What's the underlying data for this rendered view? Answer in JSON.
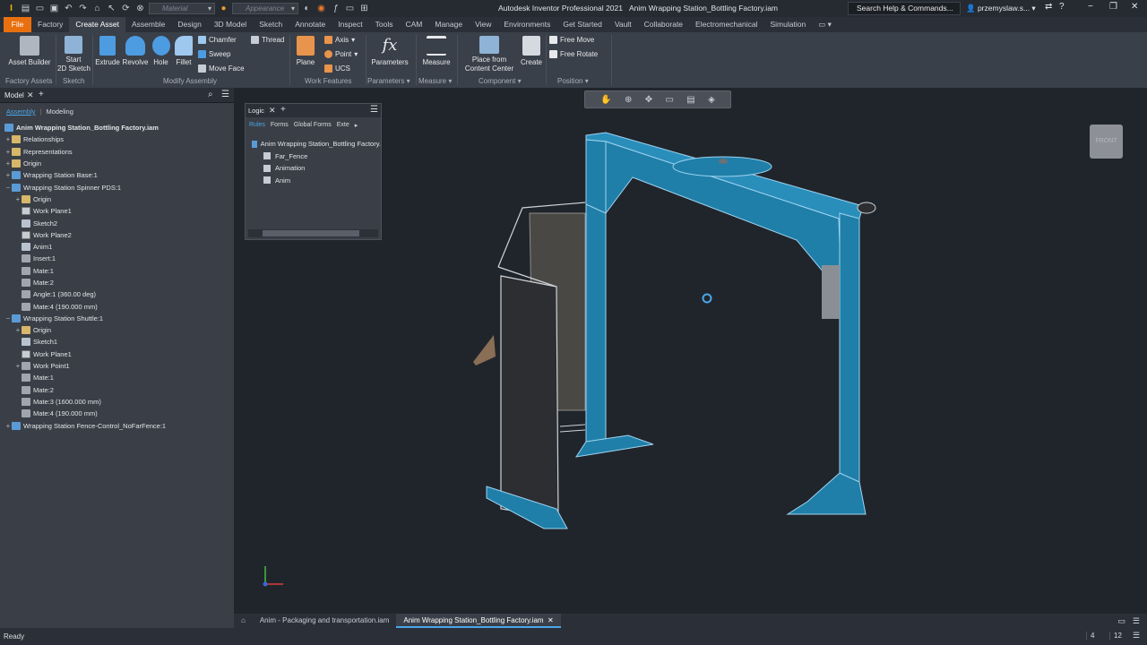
{
  "title": {
    "app": "Autodesk Inventor Professional 2021",
    "document": "Anim Wrapping Station_Bottling Factory.iam",
    "material_placeholder": "Material",
    "appearance_placeholder": "Appearance",
    "search": "Search Help & Commands...",
    "user": "przemyslaw.s..."
  },
  "menu": {
    "file": "File",
    "tabs": [
      "Factory",
      "Create Asset",
      "Assemble",
      "Design",
      "3D Model",
      "Sketch",
      "Annotate",
      "Inspect",
      "Tools",
      "CAM",
      "Manage",
      "View",
      "Environments",
      "Get Started",
      "Vault",
      "Collaborate",
      "Electromechanical",
      "Simulation"
    ],
    "active_tab": "Create Asset"
  },
  "ribbon": {
    "asset_builder": "Asset Builder",
    "start_sketch_1": "Start",
    "start_sketch_2": "2D Sketch",
    "extrude": "Extrude",
    "revolve": "Revolve",
    "hole": "Hole",
    "fillet": "Fillet",
    "chamfer": "Chamfer",
    "thread": "Thread",
    "sweep": "Sweep",
    "move_face": "Move Face",
    "plane": "Plane",
    "axis": "Axis",
    "point": "Point",
    "ucs": "UCS",
    "parameters": "Parameters",
    "measure": "Measure",
    "place_content_1": "Place from",
    "place_content_2": "Content Center",
    "create": "Create",
    "free_move": "Free Move",
    "free_rotate": "Free Rotate",
    "panels": {
      "factory_assets": "Factory Assets",
      "sketch": "Sketch",
      "modify_assembly": "Modify Assembly",
      "work_features": "Work Features",
      "parameters": "Parameters",
      "measure": "Measure",
      "component": "Component",
      "position": "Position"
    }
  },
  "browser": {
    "tab": "Model",
    "subtabs": [
      "Assembly",
      "Modeling"
    ],
    "root": "Anim Wrapping Station_Bottling Factory.iam",
    "items": [
      {
        "label": "Relationships",
        "level": 0,
        "exp": "+",
        "icon": "folder"
      },
      {
        "label": "Representations",
        "level": 0,
        "exp": "+",
        "icon": "folder"
      },
      {
        "label": "Origin",
        "level": 0,
        "exp": "+",
        "icon": "folder"
      },
      {
        "label": "Wrapping Station Base:1",
        "level": 0,
        "exp": "+",
        "icon": "part"
      },
      {
        "label": "Wrapping Station Spinner PDS:1",
        "level": 0,
        "exp": "−",
        "icon": "part"
      },
      {
        "label": "Origin",
        "level": 1,
        "exp": "+",
        "icon": "folder"
      },
      {
        "label": "Work Plane1",
        "level": 1,
        "exp": "",
        "icon": "plane"
      },
      {
        "label": "Sketch2",
        "level": 1,
        "exp": "",
        "icon": "sketch"
      },
      {
        "label": "Work Plane2",
        "level": 1,
        "exp": "",
        "icon": "plane"
      },
      {
        "label": "Anim1",
        "level": 1,
        "exp": "",
        "icon": "sketch"
      },
      {
        "label": "Insert:1",
        "level": 1,
        "exp": "",
        "icon": "constraint"
      },
      {
        "label": "Mate:1",
        "level": 1,
        "exp": "",
        "icon": "constraint"
      },
      {
        "label": "Mate:2",
        "level": 1,
        "exp": "",
        "icon": "constraint"
      },
      {
        "label": "Angle:1 (360.00 deg)",
        "level": 1,
        "exp": "",
        "icon": "constraint"
      },
      {
        "label": "Mate:4 (190.000 mm)",
        "level": 1,
        "exp": "",
        "icon": "constraint"
      },
      {
        "label": "Wrapping Station Shuttle:1",
        "level": 0,
        "exp": "−",
        "icon": "part"
      },
      {
        "label": "Origin",
        "level": 1,
        "exp": "+",
        "icon": "folder"
      },
      {
        "label": "Sketch1",
        "level": 1,
        "exp": "",
        "icon": "sketch"
      },
      {
        "label": "Work Plane1",
        "level": 1,
        "exp": "",
        "icon": "plane"
      },
      {
        "label": "Work Point1",
        "level": 1,
        "exp": "+",
        "icon": "constraint"
      },
      {
        "label": "Mate:1",
        "level": 1,
        "exp": "",
        "icon": "constraint"
      },
      {
        "label": "Mate:2",
        "level": 1,
        "exp": "",
        "icon": "constraint"
      },
      {
        "label": "Mate:3 (1600.000 mm)",
        "level": 1,
        "exp": "",
        "icon": "constraint"
      },
      {
        "label": "Mate:4 (190.000 mm)",
        "level": 1,
        "exp": "",
        "icon": "constraint"
      },
      {
        "label": "Wrapping Station Fence-Control_NoFarFence:1",
        "level": 0,
        "exp": "+",
        "icon": "part"
      }
    ]
  },
  "logic": {
    "tab": "Logic",
    "subtabs": [
      "Rules",
      "Forms",
      "Global Forms",
      "Exte"
    ],
    "root": "Anim Wrapping Station_Bottling Factory.",
    "rules": [
      "Far_Fence",
      "Animation",
      "Anim"
    ]
  },
  "viewcube": "FRONT",
  "doc_tabs": [
    "Anim - Packaging and transportation.iam",
    "Anim Wrapping Station_Bottling Factory.iam"
  ],
  "status": {
    "text": "Ready",
    "n1": "4",
    "n2": "12"
  },
  "colors": {
    "accent": "#4ca6e8",
    "file": "#e8700f",
    "model": "#1f7fa8"
  }
}
